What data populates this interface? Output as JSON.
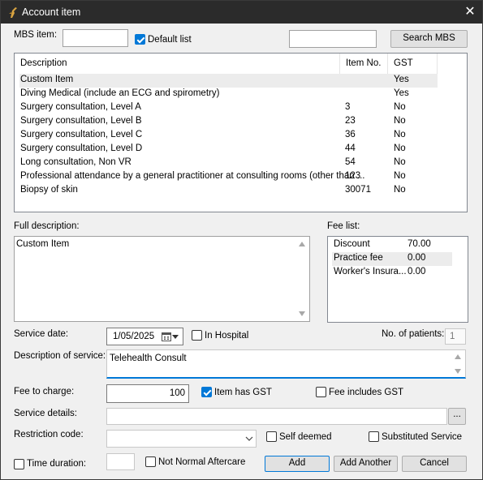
{
  "window": {
    "title": "Account item",
    "close_glyph": "✕",
    "logo_icon": "app-logo-icon"
  },
  "mbs": {
    "label": "MBS item:",
    "item_value": "",
    "default_list_label": "Default list",
    "default_list_checked": true,
    "search_value": "",
    "search_button": "Search MBS"
  },
  "table": {
    "headers": [
      "Description",
      "Item No.",
      "GST"
    ],
    "rows": [
      {
        "desc": "Custom Item",
        "item": "",
        "gst": "Yes",
        "selected": true
      },
      {
        "desc": "Diving Medical (include an ECG and spirometry)",
        "item": "",
        "gst": "Yes"
      },
      {
        "desc": "Surgery consultation, Level A",
        "item": "3",
        "gst": "No"
      },
      {
        "desc": "Surgery consultation, Level B",
        "item": "23",
        "gst": "No"
      },
      {
        "desc": "Surgery consultation, Level C",
        "item": "36",
        "gst": "No"
      },
      {
        "desc": "Surgery consultation, Level D",
        "item": "44",
        "gst": "No"
      },
      {
        "desc": "Long consultation, Non VR",
        "item": "54",
        "gst": "No"
      },
      {
        "desc": "Professional attendance by a general practitioner at consulting rooms (other than ...",
        "item": "123",
        "gst": "No"
      },
      {
        "desc": "Biopsy of skin",
        "item": "30071",
        "gst": "No"
      }
    ]
  },
  "full_description": {
    "label": "Full description:",
    "value": "Custom Item"
  },
  "fee_list": {
    "label": "Fee list:",
    "rows": [
      {
        "name": "Discount",
        "value": "70.00"
      },
      {
        "name": "Practice fee",
        "value": "0.00",
        "selected": true
      },
      {
        "name": "Worker's Insura...",
        "value": "0.00"
      }
    ]
  },
  "service": {
    "date_label": "Service date:",
    "date_value": "1/05/2025",
    "in_hospital_label": "In Hospital",
    "patients_label": "No. of patients:",
    "patients_value": "1",
    "desc_label": "Description of service:",
    "desc_value": "Telehealth Consult"
  },
  "fee": {
    "label": "Fee to charge:",
    "value": "100",
    "item_has_gst_label": "Item has GST",
    "item_has_gst_checked": true,
    "fee_includes_gst_label": "Fee includes GST"
  },
  "details": {
    "label": "Service details:",
    "value": "",
    "browse": "..."
  },
  "restriction": {
    "label": "Restriction code:",
    "value": "",
    "self_deemed_label": "Self deemed",
    "substituted_label": "Substituted Service"
  },
  "footer": {
    "time_duration_label": "Time duration:",
    "time_value": "",
    "not_normal_label": "Not Normal Aftercare",
    "add": "Add",
    "add_another": "Add Another",
    "cancel": "Cancel"
  }
}
